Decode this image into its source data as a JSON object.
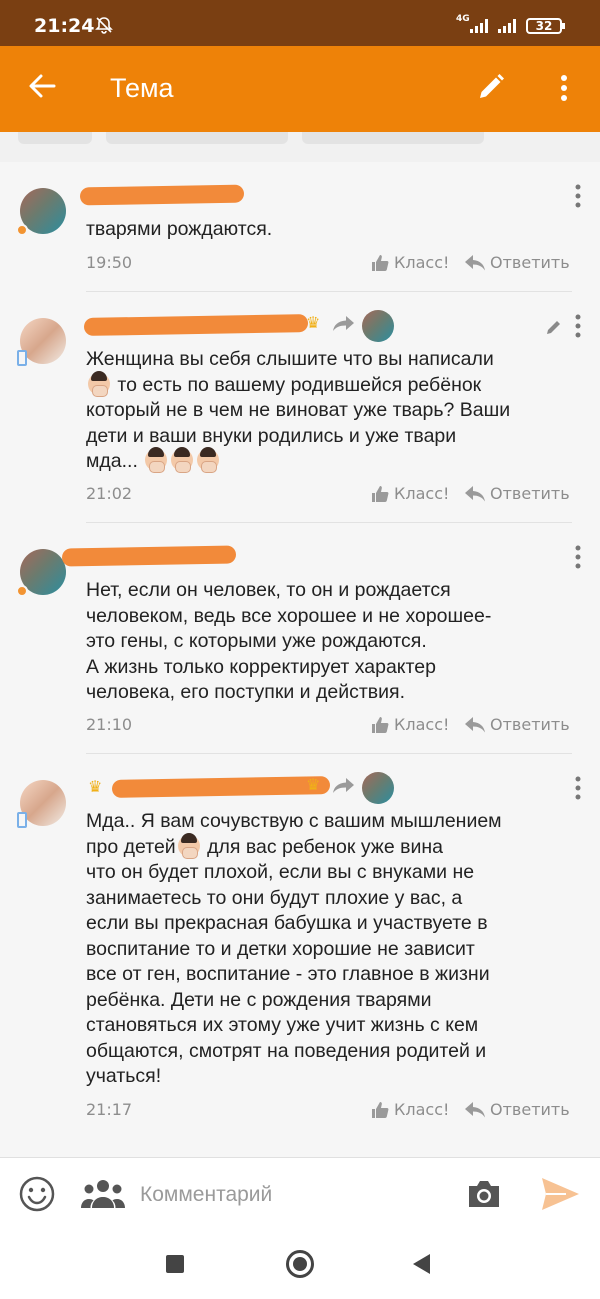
{
  "status_bar": {
    "time": "21:24",
    "network": "4G",
    "battery": "32"
  },
  "app_bar": {
    "title": "Тема"
  },
  "comments": [
    {
      "text": "тварями рождаются.",
      "time": "19:50",
      "like_label": "Класс!",
      "reply_label": "Ответить"
    },
    {
      "text_parts": [
        "Женщина вы себя слышите что вы написали",
        " то есть по вашему родившейся ребёнок",
        "который не в чем не виноват уже тварь? Ваши",
        "дети и ваши внуки родились и уже твари",
        "мда..."
      ],
      "time": "21:02",
      "like_label": "Класс!",
      "reply_label": "Ответить"
    },
    {
      "text": "Нет, если он человек, то он и рождается\nчеловеком,  ведь все хорошее и не хорошее-\nэто гены, с которыми уже рождаются.\nА жизнь только корректирует характер\nчеловека, его поступки и действия.",
      "time": "21:10",
      "like_label": "Класс!",
      "reply_label": "Ответить"
    },
    {
      "text_parts": [
        "Мда.. Я вам сочувствую с вашим мышлением",
        "про детей",
        " для вас ребенок уже вина",
        "что он будет плохой, если вы с внуками не\nзанимаетесь то они будут плохие у вас, а\nесли вы прекрасная бабушка и участвуете в\nвоспитание то и детки хорошие не зависит\nвсе от ген, воспитание - это главное в жизни\nребёнка. Дети не с рождения тварями\nстановяться их этому уже учит жизнь с кем\nобщаются, смотрят на поведения родитей и\nучаться!"
      ],
      "time": "21:17",
      "like_label": "Класс!",
      "reply_label": "Ответить"
    }
  ],
  "input": {
    "placeholder": "Комментарий"
  },
  "colors": {
    "accent": "#ee8208",
    "status_bar": "#7a3f12",
    "redaction": "#f28a3a"
  }
}
